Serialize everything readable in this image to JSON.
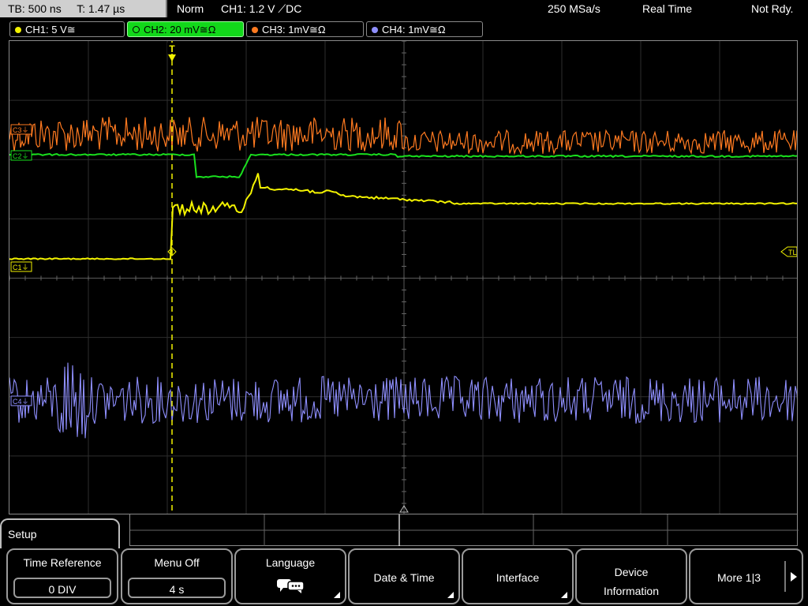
{
  "status": {
    "timebase": "TB: 500 ns",
    "trigger_time": "T: 1.47 µs",
    "mode": "Norm",
    "trigger": "CH1: 1.2 V ⟋DC",
    "sample_rate": "250 MSa/s",
    "acq_mode": "Real Time",
    "ready_state": "Not Rdy."
  },
  "channels": [
    {
      "label": "CH1: 5 V≅",
      "color": "#f2f200",
      "active": false
    },
    {
      "label": "CH2: 20 mV≅Ω",
      "color": "#19e01e",
      "active": true
    },
    {
      "label": "CH3: 1mV≅Ω",
      "color": "#ff7a20",
      "active": false
    },
    {
      "label": "CH4: 1mV≅Ω",
      "color": "#8f8fff",
      "active": false
    }
  ],
  "markers": {
    "c1": "C1⏚",
    "c2": "C2⏚",
    "c3": "C3⏚",
    "c4": "C4⏚",
    "trigger_level": "TL",
    "trigger_pos": "T"
  },
  "menu": {
    "title": "Setup",
    "softkeys": [
      {
        "label": "Time Reference",
        "value": "0 DIV"
      },
      {
        "label": "Menu Off",
        "value": "4 s"
      },
      {
        "label": "Language",
        "icon": "speech-bubble-icon"
      },
      {
        "label": "Date & Time"
      },
      {
        "label": "Interface"
      },
      {
        "label": "Device Information"
      },
      {
        "label": "More 1|3"
      }
    ]
  },
  "colors": {
    "ch1": "#f2f200",
    "ch2": "#19e01e",
    "ch3": "#ff7a20",
    "ch4": "#8f8fff",
    "grid": "#8a8a8a",
    "active_tab": "#12d81a"
  }
}
